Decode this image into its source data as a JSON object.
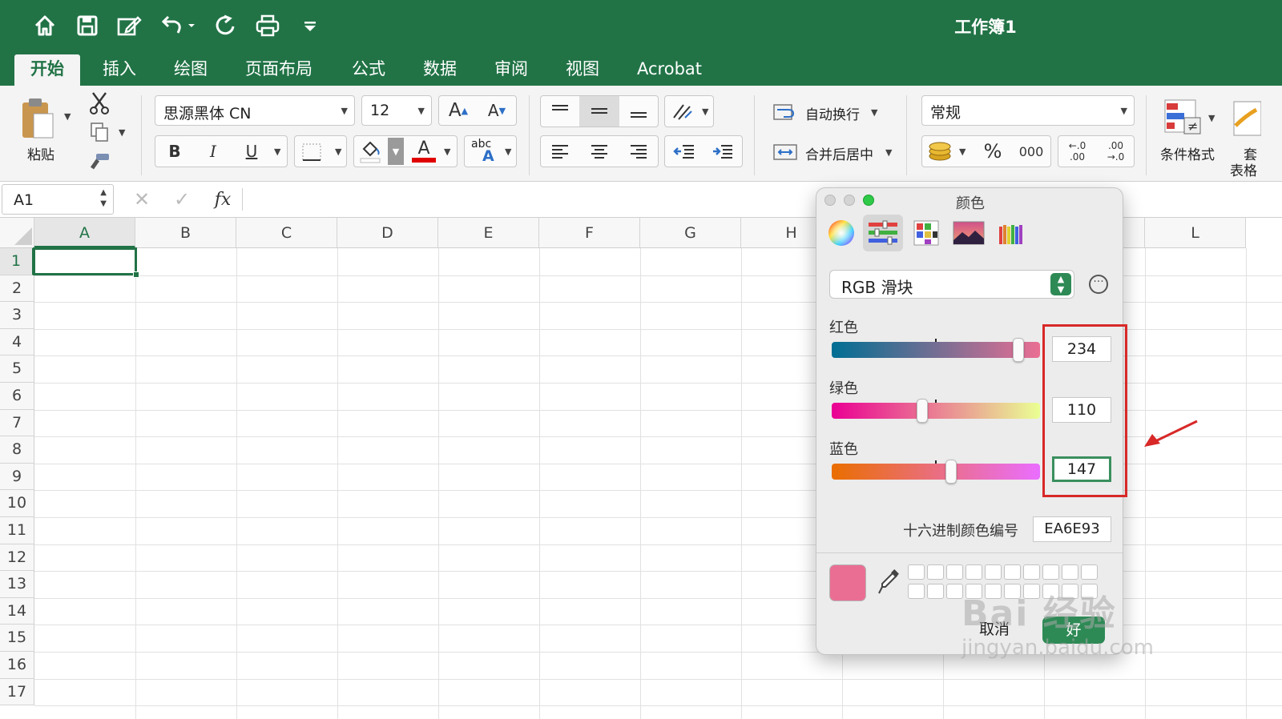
{
  "window": {
    "title": "工作簿1"
  },
  "quick_access": [
    "home-icon",
    "save-icon",
    "edit-icon",
    "undo-icon",
    "redo-icon",
    "print-icon",
    "customize-icon"
  ],
  "tabs": [
    {
      "label": "开始",
      "active": true
    },
    {
      "label": "插入"
    },
    {
      "label": "绘图"
    },
    {
      "label": "页面布局"
    },
    {
      "label": "公式"
    },
    {
      "label": "数据"
    },
    {
      "label": "审阅"
    },
    {
      "label": "视图"
    },
    {
      "label": "Acrobat"
    }
  ],
  "ribbon": {
    "paste_label": "粘贴",
    "font_name": "思源黑体 CN",
    "font_size": "12",
    "grow_font": "A",
    "shrink_font": "A",
    "bold": "B",
    "italic": "I",
    "underline": "U",
    "font_color_glyph": "A",
    "phonetic_small": "abc",
    "phonetic_big": "A",
    "wrap_text": "自动换行",
    "merge_center": "合并后居中",
    "number_format": "常规",
    "percent": "%",
    "thousands": "000",
    "decimal_add_top": "←.0",
    "decimal_add_bottom": ".00",
    "decimal_remove_top": ".00",
    "decimal_remove_bottom": "→.0",
    "conditional_format": "条件格式",
    "table_format_top": "套",
    "table_format_bottom": "表格",
    "fill_color": "#ffffff",
    "font_color": "#e00000"
  },
  "formula_bar": {
    "name_box": "A1",
    "fx": "fx"
  },
  "grid": {
    "columns": [
      "A",
      "B",
      "C",
      "D",
      "E",
      "F",
      "G",
      "H",
      "",
      "",
      "",
      "L"
    ],
    "rows": [
      "1",
      "2",
      "3",
      "4",
      "5",
      "6",
      "7",
      "8",
      "9",
      "10",
      "11",
      "12",
      "13",
      "14",
      "15",
      "16",
      "17"
    ],
    "selected_cell": "A1"
  },
  "color_dialog": {
    "title": "颜色",
    "mode_select": "RGB 滑块",
    "red_label": "红色",
    "green_label": "绿色",
    "blue_label": "蓝色",
    "red_value": "234",
    "green_value": "110",
    "blue_value": "147",
    "red_level": 234,
    "green_level": 110,
    "blue_level": 147,
    "hex_label": "十六进制颜色编号",
    "hex_value": "EA6E93",
    "current_color": "#EA6E93",
    "cancel_label": "取消",
    "ok_label": "好"
  },
  "annotation": {
    "color": "#d82828"
  },
  "watermark": {
    "line1": "Bai 经验",
    "line2": "jingyan.baidu.com"
  }
}
